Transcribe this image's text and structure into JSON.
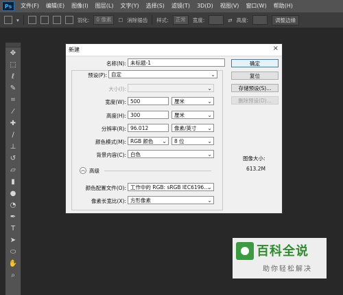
{
  "app": {
    "logo": "Ps"
  },
  "menu": [
    "文件(F)",
    "编辑(E)",
    "图像(I)",
    "图层(L)",
    "文字(Y)",
    "选择(S)",
    "滤镜(T)",
    "3D(D)",
    "视图(V)",
    "窗口(W)",
    "帮助(H)"
  ],
  "options": {
    "feather_label": "羽化:",
    "feather_value": "0 像素",
    "antialias_label": "消除锯齿",
    "style_label": "样式:",
    "style_value": "正常",
    "width_label": "宽度:",
    "height_label": "高度:",
    "refine_edge_button": "调整边缘"
  },
  "dialog": {
    "title": "新建",
    "close": "×",
    "name_label": "名称(N):",
    "name_value": "未标题-1",
    "preset_label": "预设(P):",
    "preset_value": "自定",
    "size_label": "大小(I):",
    "width_label": "宽度(W):",
    "width_value": "500",
    "width_unit": "厘米",
    "height_label": "高度(H):",
    "height_value": "300",
    "height_unit": "厘米",
    "resolution_label": "分辨率(R):",
    "resolution_value": "96.012",
    "resolution_unit": "像素/英寸",
    "color_mode_label": "颜色模式(M):",
    "color_mode_value": "RGB 颜色",
    "bit_depth_value": "8 位",
    "background_label": "背景内容(C):",
    "background_value": "白色",
    "advanced_label": "高级",
    "color_profile_label": "颜色配置文件(O):",
    "color_profile_value": "工作中的 RGB: sRGB IEC6196...",
    "pixel_aspect_label": "像素长宽比(X):",
    "pixel_aspect_value": "方形像素",
    "ok_button": "确定",
    "reset_button": "复位",
    "save_preset_button": "存储预设(S)...",
    "delete_preset_button": "删除预设(D)...",
    "image_size_label": "图像大小:",
    "image_size_value": "613.2M"
  },
  "watermark": {
    "title": "百科全说",
    "subtitle": "助你轻松解决"
  },
  "colors": {
    "accent": "#3c7fb1",
    "brand_green": "#2e8b2e"
  }
}
